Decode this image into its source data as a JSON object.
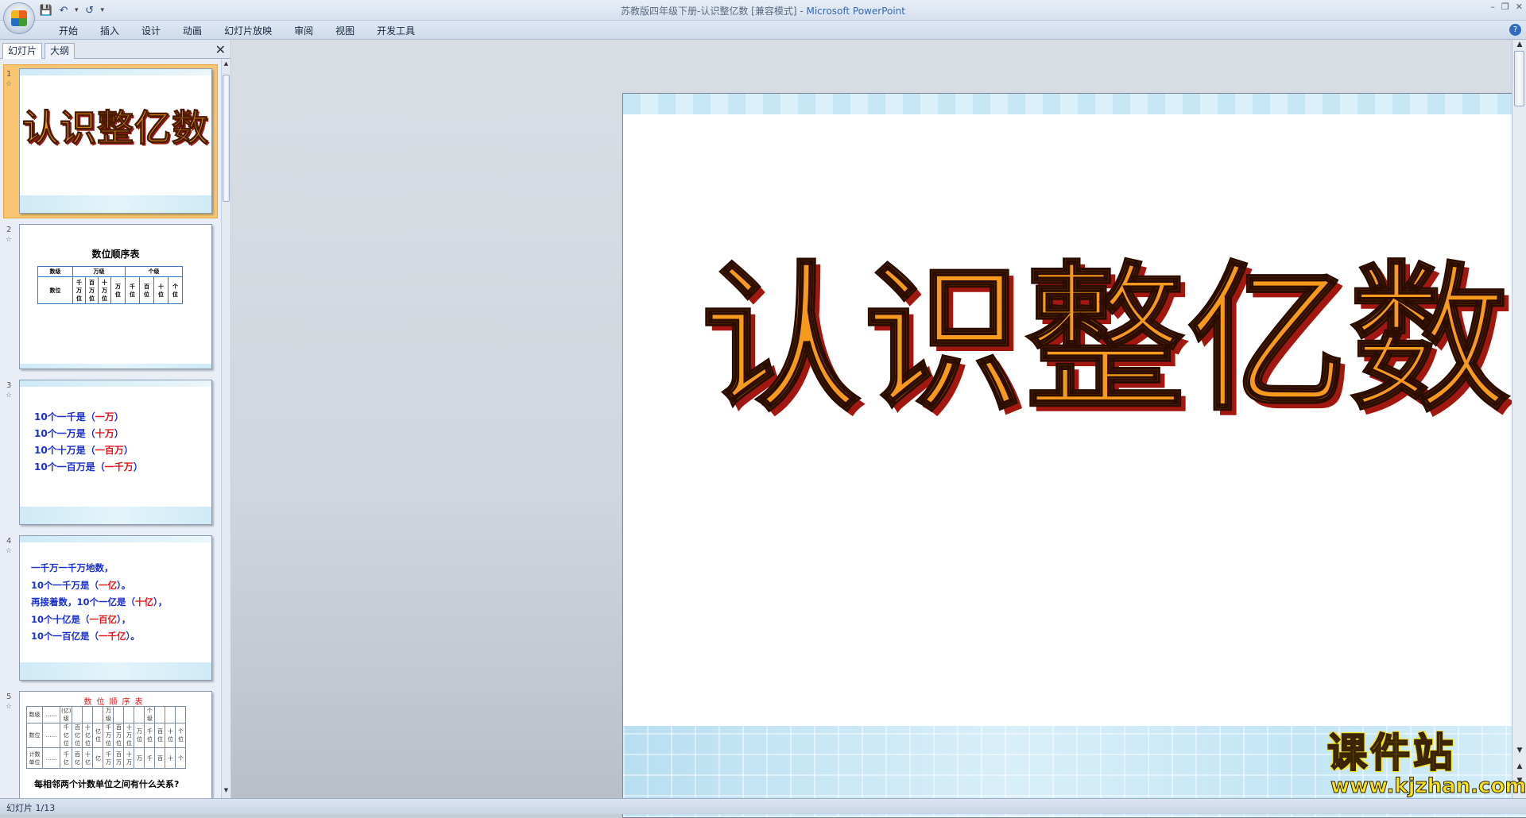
{
  "window": {
    "title_doc": "苏教版四年级下册-认识整亿数 [兼容模式] - ",
    "title_app": "Microsoft PowerPoint"
  },
  "ribbon": {
    "tabs": [
      "开始",
      "插入",
      "设计",
      "动画",
      "幻灯片放映",
      "审阅",
      "视图",
      "开发工具"
    ]
  },
  "left_pane": {
    "tabs": [
      "幻灯片",
      "大纲"
    ],
    "slides": [
      {
        "num": "1",
        "title": "认识整亿数"
      },
      {
        "num": "2",
        "title": "数位顺序表",
        "table": {
          "row1": [
            "数级",
            "万级",
            "个级"
          ],
          "row2_label": "数位",
          "cells": [
            "千万位",
            "百万位",
            "十万位",
            "万位",
            "千位",
            "百位",
            "十位",
            "个位"
          ]
        }
      },
      {
        "num": "3",
        "lines": [
          {
            "text": "10个一千是（",
            "ans": "一万",
            "end": "）"
          },
          {
            "text": "10个一万是（",
            "ans": "十万",
            "end": "）"
          },
          {
            "text": "10个十万是（",
            "ans": "一百万",
            "end": "）"
          },
          {
            "text": "10个一百万是（",
            "ans": "一千万",
            "end": "）"
          }
        ]
      },
      {
        "num": "4",
        "intro": "一千万一千万地数，",
        "lines": [
          {
            "text": "10个一千万是（",
            "ans": "一亿",
            "end": "）。"
          },
          {
            "text": "再接着数，10个一亿是（",
            "ans": "十亿",
            "end": "），"
          },
          {
            "text": "10个十亿是（",
            "ans": "一百亿",
            "end": "），"
          },
          {
            "text": "10个一百亿是（",
            "ans": "一千亿",
            "end": "）。"
          }
        ]
      },
      {
        "num": "5",
        "head": "数位顺序表",
        "question": "每相邻两个计数单位之间有什么关系?",
        "rows": [
          [
            "数级",
            "……",
            "(亿)级",
            "",
            "",
            "",
            "万级",
            "",
            "",
            "",
            "个级",
            "",
            "",
            ""
          ],
          [
            "数位",
            "……",
            "千亿位",
            "百亿位",
            "十亿位",
            "亿位",
            "千万位",
            "百万位",
            "十万位",
            "万位",
            "千位",
            "百位",
            "十位",
            "个位"
          ],
          [
            "计数单位",
            "……",
            "千亿",
            "百亿",
            "十亿",
            "亿",
            "千万",
            "百万",
            "十万",
            "万",
            "千",
            "百",
            "十",
            "个"
          ]
        ]
      }
    ]
  },
  "slide": {
    "title": "认识整亿数"
  },
  "watermark": {
    "main": "课件站",
    "url": "www.kjzhan.com"
  },
  "status": {
    "text": "幻灯片 1/13"
  }
}
